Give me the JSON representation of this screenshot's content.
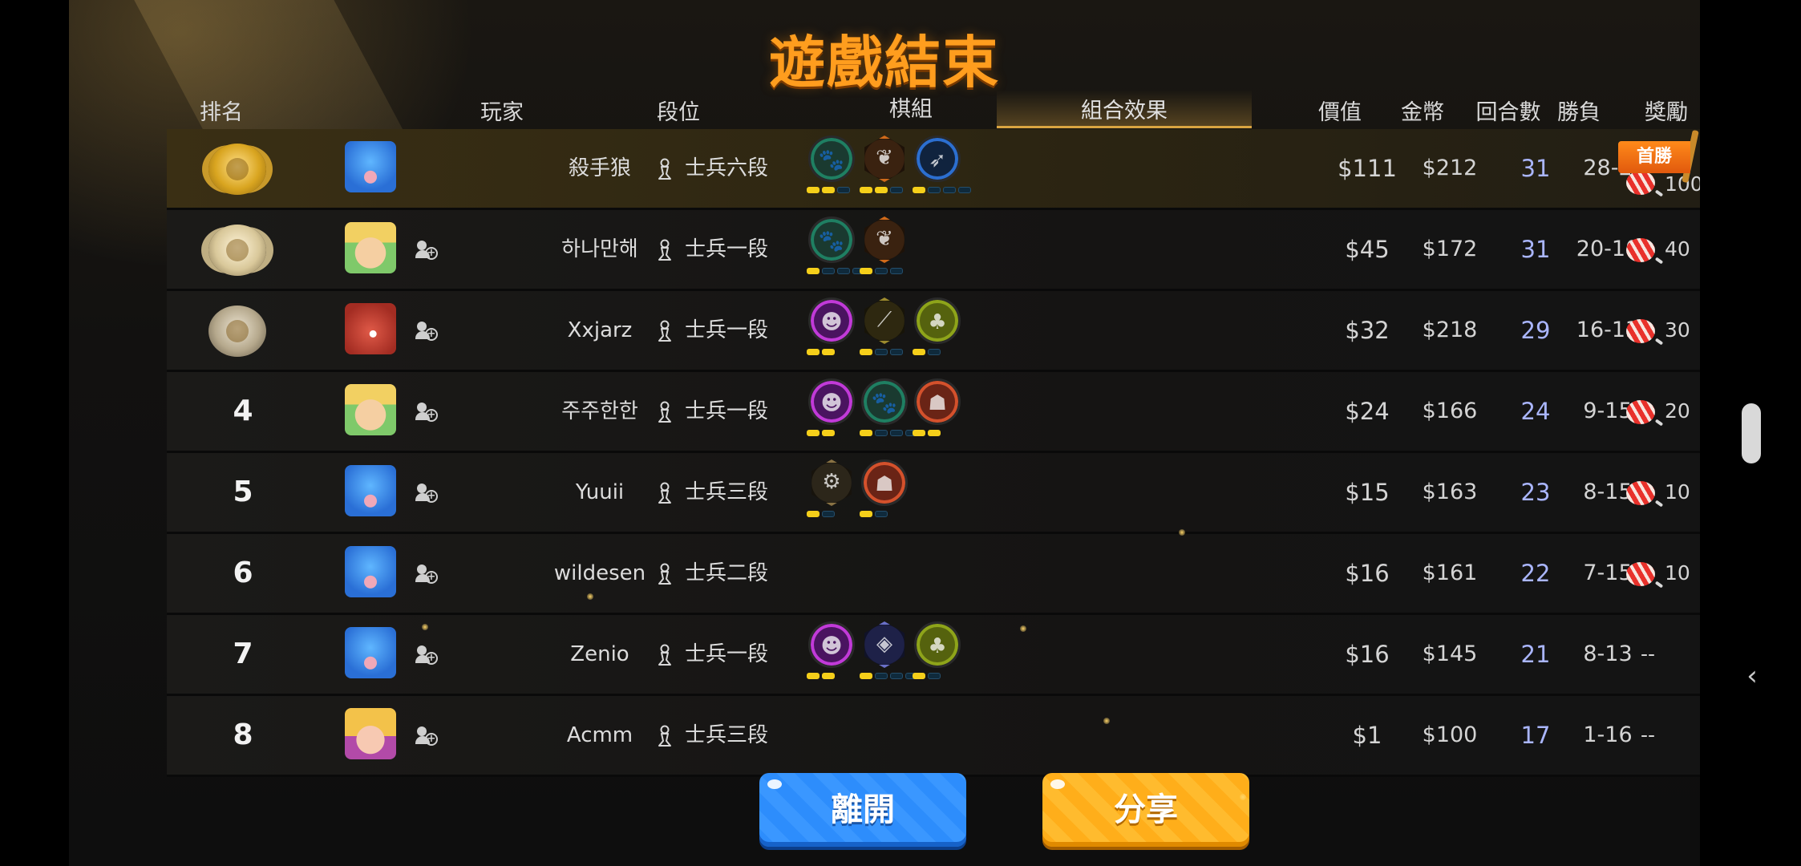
{
  "title": "遊戲結束",
  "headers": {
    "rank": "排名",
    "player": "玩家",
    "tier": "段位",
    "set": "棋組",
    "synergy": "組合效果",
    "value": "價值",
    "gold": "金幣",
    "rounds": "回合數",
    "winloss": "勝負",
    "reward": "獎勵"
  },
  "first_win_label": "首勝",
  "rows": [
    {
      "rank": "1",
      "medal": "gold",
      "avatar": "blue-bird",
      "name": "殺手狼",
      "tier": "士兵六段",
      "traits": [
        "paw-green",
        "leaf-orange",
        "feather-blue"
      ],
      "value": "$111",
      "gold": "$212",
      "rounds": "31",
      "winloss": "28-2",
      "reward": "100"
    },
    {
      "rank": "2",
      "medal": "silver",
      "avatar": "elf",
      "name": "하나만해",
      "tier": "士兵一段",
      "traits": [
        "paw-green",
        "leaf-orange"
      ],
      "value": "$45",
      "gold": "$172",
      "rounds": "31",
      "winloss": "20-10",
      "reward": "40"
    },
    {
      "rank": "3",
      "medal": "bronze",
      "avatar": "red-dragon",
      "name": "Xxjarz",
      "tier": "士兵一段",
      "traits": [
        "demon-purple",
        "claw-gold",
        "cluster-olive"
      ],
      "value": "$32",
      "gold": "$218",
      "rounds": "29",
      "winloss": "16-13",
      "reward": "30"
    },
    {
      "rank": "4",
      "medal": "",
      "avatar": "elf",
      "name": "주주한한",
      "tier": "士兵一段",
      "traits": [
        "demon-purple",
        "paw-green",
        "horned-red"
      ],
      "value": "$24",
      "gold": "$166",
      "rounds": "24",
      "winloss": "9-15",
      "reward": "20"
    },
    {
      "rank": "5",
      "medal": "",
      "avatar": "blue-bird",
      "name": "Yuuii",
      "tier": "士兵三段",
      "traits": [
        "gear-grey",
        "horned-red"
      ],
      "value": "$15",
      "gold": "$163",
      "rounds": "23",
      "winloss": "8-15",
      "reward": "10"
    },
    {
      "rank": "6",
      "medal": "",
      "avatar": "blue-bird",
      "name": "wildesen",
      "tier": "士兵二段",
      "traits": [],
      "value": "$16",
      "gold": "$161",
      "rounds": "22",
      "winloss": "7-15",
      "reward": "10"
    },
    {
      "rank": "7",
      "medal": "",
      "avatar": "blue-bird",
      "name": "Zenio",
      "tier": "士兵一段",
      "traits": [
        "demon-purple",
        "beast-indigo",
        "cluster-olive"
      ],
      "value": "$16",
      "gold": "$145",
      "rounds": "21",
      "winloss": "8-13",
      "reward": "--"
    },
    {
      "rank": "8",
      "medal": "",
      "avatar": "girl",
      "name": "Acmm",
      "tier": "士兵三段",
      "traits": [],
      "value": "$1",
      "gold": "$100",
      "rounds": "17",
      "winloss": "1-16",
      "reward": "--"
    }
  ],
  "buttons": {
    "leave": "離開",
    "share": "分享"
  },
  "colors": {
    "title": "#ff9d1e",
    "blue_button": "#2d8dfc",
    "yellow_button": "#ffae1a",
    "pip_on": "#f5cf1a",
    "rounds_text": "#aab6ff"
  }
}
